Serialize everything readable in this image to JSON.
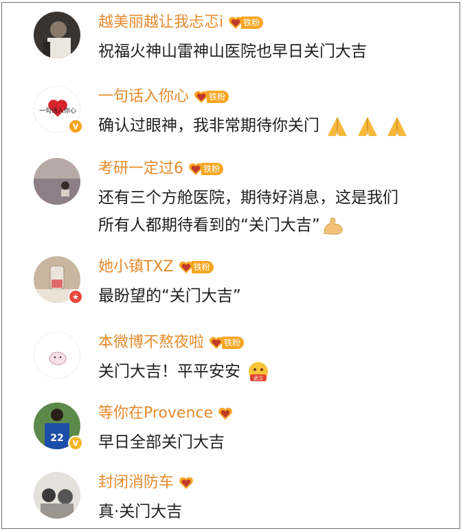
{
  "comments": [
    {
      "user": "越美丽越让我忐忑i",
      "fan_tag": "铁粉",
      "text": "祝福火神山雷神山医院也早日关门大吉"
    },
    {
      "user": "一句话入你心",
      "fan_tag": "铁粉",
      "avatar_text": "一句话入你心",
      "badge": "V",
      "text": "确认过眼神，我非常期待你关门",
      "emoji": [
        "pray-emoji",
        "pray-emoji",
        "pray-emoji"
      ]
    },
    {
      "user": "考研一定过6",
      "fan_tag": "铁粉",
      "text_lines": [
        "还有三个方舱医院，期待好消息，这是我们",
        "所有人都期待看到的“关门大吉”"
      ],
      "emoji": [
        "muscle-emoji"
      ]
    },
    {
      "user": "她小镇TXZ",
      "fan_tag": "铁粉",
      "text": "最盼望的“关门大吉”"
    },
    {
      "user": "本微博不熬夜啦",
      "fan_tag": "铁粉",
      "text": "关门大吉！平平安安",
      "emoji": [
        "wuhan-jiayou-emoji"
      ],
      "emoji_text": "武汉"
    },
    {
      "user": "等你在Provence",
      "badge": "V",
      "avatar_text": "22",
      "text": "早日全部关门大吉"
    },
    {
      "user": "封闭消防车",
      "text": "真·关门大吉"
    }
  ],
  "colors": {
    "username": "#e58a2b",
    "text": "#1e1e1e",
    "fan_badge": "#f6a623"
  }
}
